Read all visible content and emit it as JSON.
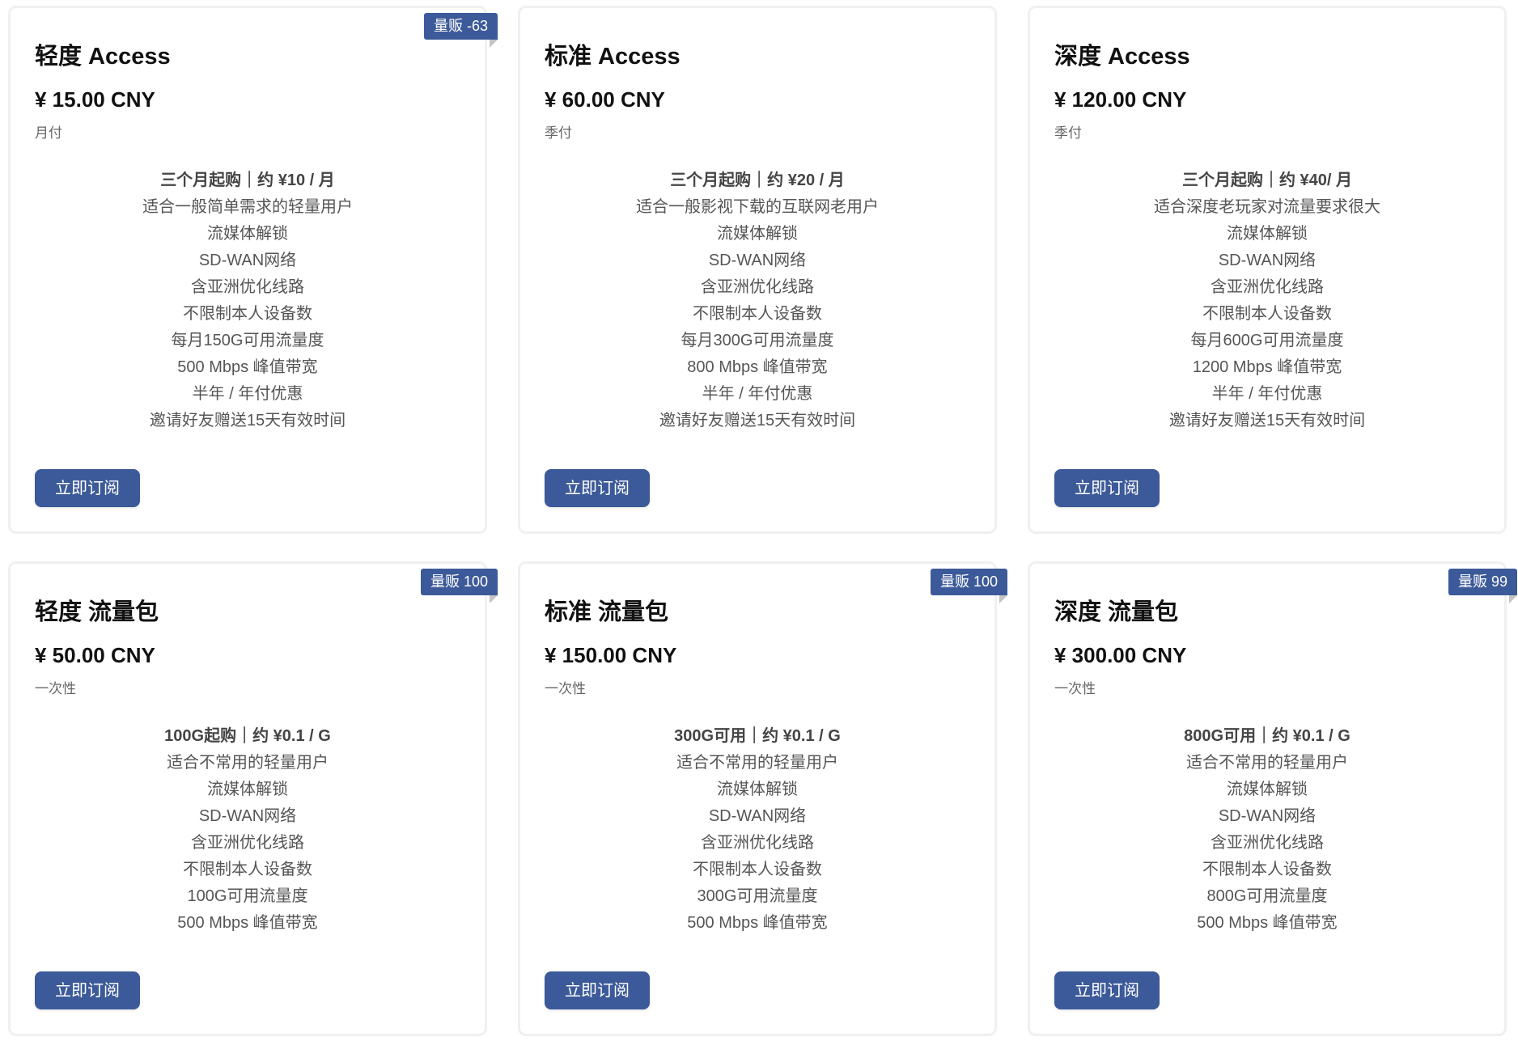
{
  "subscribe_label": "立即订阅",
  "colors": {
    "accent": "#3c5a99"
  },
  "plans": [
    {
      "title": "轻度 Access",
      "price": "¥ 15.00 CNY",
      "period": "月付",
      "badge": "量贩 -63",
      "features": [
        "三个月起购｜约 ¥10 / 月",
        "适合一般简单需求的轻量用户",
        "流媒体解锁",
        "SD-WAN网络",
        "含亚洲优化线路",
        "不限制本人设备数",
        "每月150G可用流量度",
        "500 Mbps 峰值带宽",
        "半年 / 年付优惠",
        "邀请好友赠送15天有效时间"
      ]
    },
    {
      "title": "标准 Access",
      "price": "¥ 60.00 CNY",
      "period": "季付",
      "badge": null,
      "features": [
        "三个月起购｜约 ¥20 / 月",
        "适合一般影视下载的互联网老用户",
        "流媒体解锁",
        "SD-WAN网络",
        "含亚洲优化线路",
        "不限制本人设备数",
        "每月300G可用流量度",
        "800 Mbps 峰值带宽",
        "半年 / 年付优惠",
        "邀请好友赠送15天有效时间"
      ]
    },
    {
      "title": "深度 Access",
      "price": "¥ 120.00 CNY",
      "period": "季付",
      "badge": null,
      "features": [
        "三个月起购｜约 ¥40/ 月",
        "适合深度老玩家对流量要求很大",
        "流媒体解锁",
        "SD-WAN网络",
        "含亚洲优化线路",
        "不限制本人设备数",
        "每月600G可用流量度",
        "1200 Mbps 峰值带宽",
        "半年 / 年付优惠",
        "邀请好友赠送15天有效时间"
      ]
    },
    {
      "title": "轻度 流量包",
      "price": "¥ 50.00 CNY",
      "period": "一次性",
      "badge": "量贩 100",
      "features": [
        "100G起购｜约 ¥0.1 / G",
        "适合不常用的轻量用户",
        "流媒体解锁",
        "SD-WAN网络",
        "含亚洲优化线路",
        "不限制本人设备数",
        "100G可用流量度",
        "500 Mbps 峰值带宽"
      ]
    },
    {
      "title": "标准 流量包",
      "price": "¥ 150.00 CNY",
      "period": "一次性",
      "badge": "量贩 100",
      "features": [
        "300G可用｜约 ¥0.1 / G",
        "适合不常用的轻量用户",
        "流媒体解锁",
        "SD-WAN网络",
        "含亚洲优化线路",
        "不限制本人设备数",
        "300G可用流量度",
        "500 Mbps 峰值带宽"
      ]
    },
    {
      "title": "深度 流量包",
      "price": "¥ 300.00 CNY",
      "period": "一次性",
      "badge": "量贩 99",
      "features": [
        "800G可用｜约 ¥0.1 / G",
        "适合不常用的轻量用户",
        "流媒体解锁",
        "SD-WAN网络",
        "含亚洲优化线路",
        "不限制本人设备数",
        "800G可用流量度",
        "500 Mbps 峰值带宽"
      ]
    }
  ]
}
